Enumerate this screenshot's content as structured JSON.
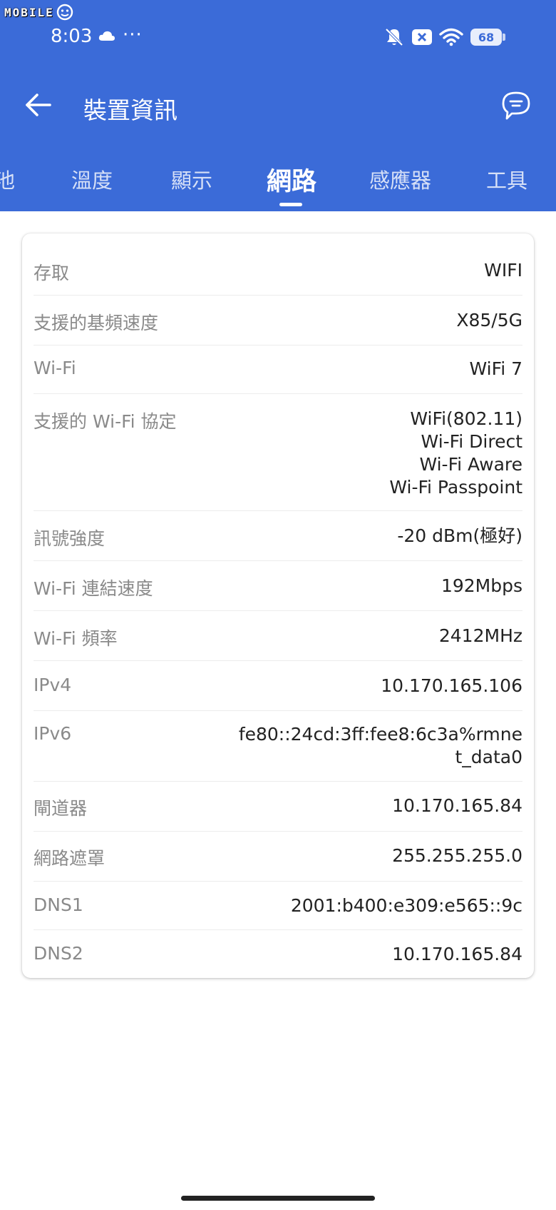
{
  "watermark": {
    "text": "MOBILE"
  },
  "status_bar": {
    "time": "8:03",
    "dots": "···",
    "battery": "68",
    "icons": [
      "cloud-icon",
      "bell-off-icon",
      "close-icon",
      "wifi-icon",
      "battery-icon"
    ]
  },
  "app_bar": {
    "title": "裝置資訊",
    "back_icon": "arrow-left-icon",
    "feedback_icon": "chat-bubble-icon"
  },
  "tabs": [
    {
      "label": "池"
    },
    {
      "label": "溫度"
    },
    {
      "label": "顯示"
    },
    {
      "label": "網路",
      "active": true
    },
    {
      "label": "感應器"
    },
    {
      "label": "工具"
    }
  ],
  "network": {
    "rows": [
      {
        "label": "存取",
        "value": "WIFI"
      },
      {
        "label": "支援的基頻速度",
        "value": "X85/5G"
      },
      {
        "label": "Wi-Fi",
        "value": "WiFi 7"
      },
      {
        "label": "支援的 Wi-Fi 協定",
        "values": [
          "WiFi(802.11)",
          "Wi-Fi Direct",
          "Wi-Fi Aware",
          "Wi-Fi Passpoint"
        ]
      },
      {
        "label": "訊號強度",
        "value": "-20 dBm(極好)"
      },
      {
        "label": "Wi-Fi 連結速度",
        "value": "192Mbps"
      },
      {
        "label": "Wi-Fi 頻率",
        "value": "2412MHz"
      },
      {
        "label": "IPv4",
        "value": "10.170.165.106"
      },
      {
        "label": "IPv6",
        "values": [
          "fe80::24cd:3ff:fee8:6c3a%rmne",
          "t_data0"
        ]
      },
      {
        "label": "閘道器",
        "value": "10.170.165.84"
      },
      {
        "label": "網路遮罩",
        "value": "255.255.255.0"
      },
      {
        "label": "DNS1",
        "value": "2001:b400:e309:e565::9c"
      },
      {
        "label": "DNS2",
        "value": "10.170.165.84"
      }
    ]
  },
  "colors": {
    "header": "#3b6bd8",
    "label": "#8a8a8a",
    "value": "#222222"
  }
}
